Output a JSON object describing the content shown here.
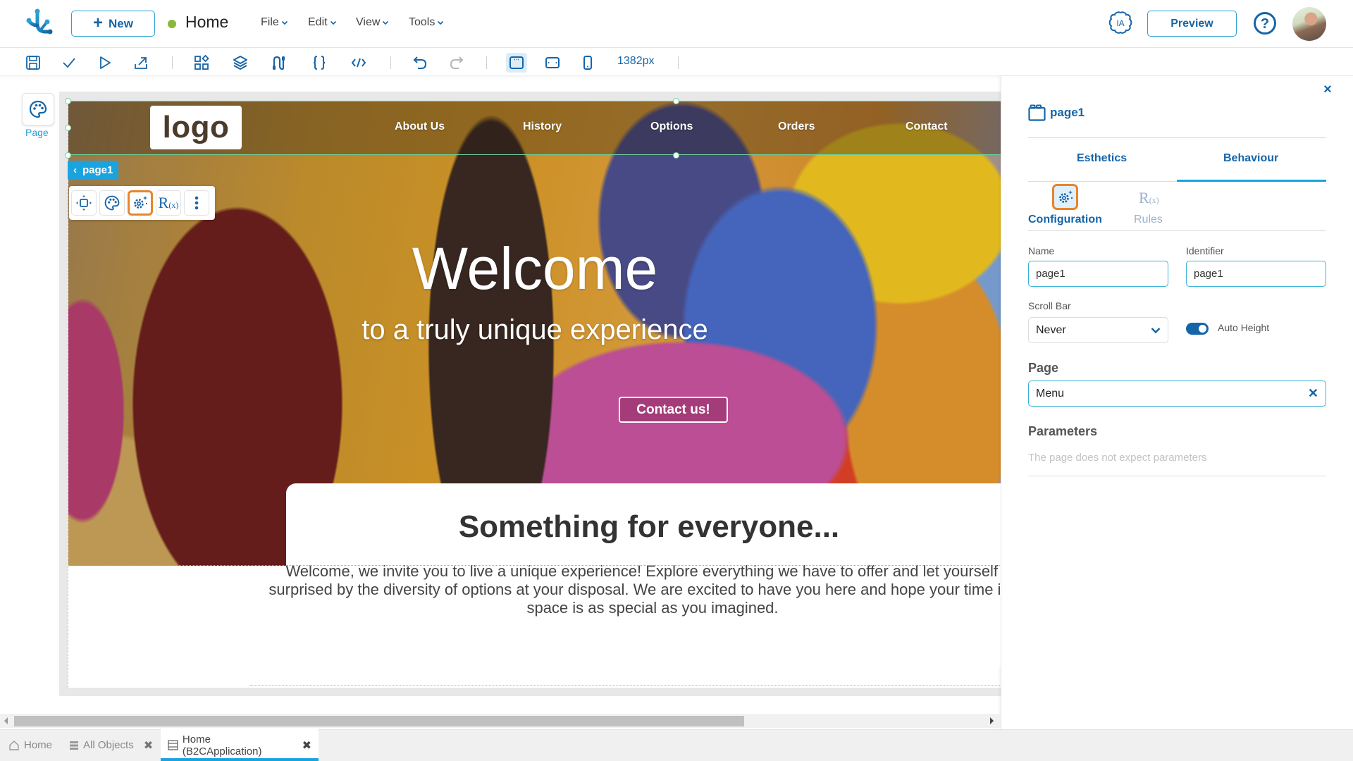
{
  "header": {
    "new_label": "New",
    "status_color": "#8bb83a",
    "doc_title": "Home",
    "menus": [
      "File",
      "Edit",
      "View",
      "Tools"
    ],
    "ia_label": "IA",
    "preview_label": "Preview",
    "help_label": "?"
  },
  "toolbar": {
    "icons": [
      "save-icon",
      "check-icon",
      "play-icon",
      "export-icon",
      "components-icon",
      "layers-icon",
      "connections-icon",
      "braces-icon",
      "code-icon",
      "undo-icon",
      "redo-icon",
      "desktop-view-icon",
      "tablet-view-icon",
      "mobile-view-icon"
    ],
    "active_view": "desktop",
    "width_label": "1382px"
  },
  "left_rail": {
    "page_label": "Page"
  },
  "canvas": {
    "selection_tag": "page1",
    "site": {
      "logo_text": "logo",
      "nav_links": [
        "About Us",
        "History",
        "Options",
        "Orders",
        "Contact"
      ],
      "hero_title": "Welcome",
      "hero_subtitle": "to a truly unique experience",
      "cta_label": "Contact us!",
      "card_title": "Something for everyone...",
      "card_text": "Welcome, we invite you to live a unique experience! Explore everything we have to offer and let yourself be surprised by the diversity of options at your disposal. We are excited to have you here and hope your time in our space is as special as you imagined."
    },
    "element_toolbar": [
      "move-icon",
      "palette-icon",
      "configuration-icon",
      "rules-icon",
      "more-icon"
    ],
    "element_toolbar_active": "configuration",
    "rules_glyph": "R",
    "rules_sub": "(x)"
  },
  "panel": {
    "title": "page1",
    "close": "×",
    "tabs": [
      "Esthetics",
      "Behaviour"
    ],
    "active_tab": "Behaviour",
    "subtabs": [
      "Configuration",
      "Rules"
    ],
    "active_subtab": "Configuration",
    "name_label": "Name",
    "name_value": "page1",
    "identifier_label": "Identifier",
    "identifier_value": "page1",
    "scrollbar_label": "Scroll Bar",
    "scrollbar_value": "Never",
    "auto_height_label": "Auto Height",
    "auto_height_on": true,
    "page_section": "Page",
    "page_value": "Menu",
    "page_clear": "✕",
    "params_section": "Parameters",
    "params_empty": "The page does not expect parameters"
  },
  "bottom_tabs": [
    {
      "label": "Home",
      "icon": "home-icon",
      "closable": false
    },
    {
      "label": "All Objects",
      "icon": "list-icon",
      "closable": true
    },
    {
      "label": "Home (B2CApplication)",
      "icon": "page-icon",
      "closable": true,
      "active": true
    }
  ],
  "colors": {
    "primary": "#1565a8",
    "accent": "#1aa3df",
    "highlight": "#e8852b",
    "selection": "#6fd3a0"
  }
}
